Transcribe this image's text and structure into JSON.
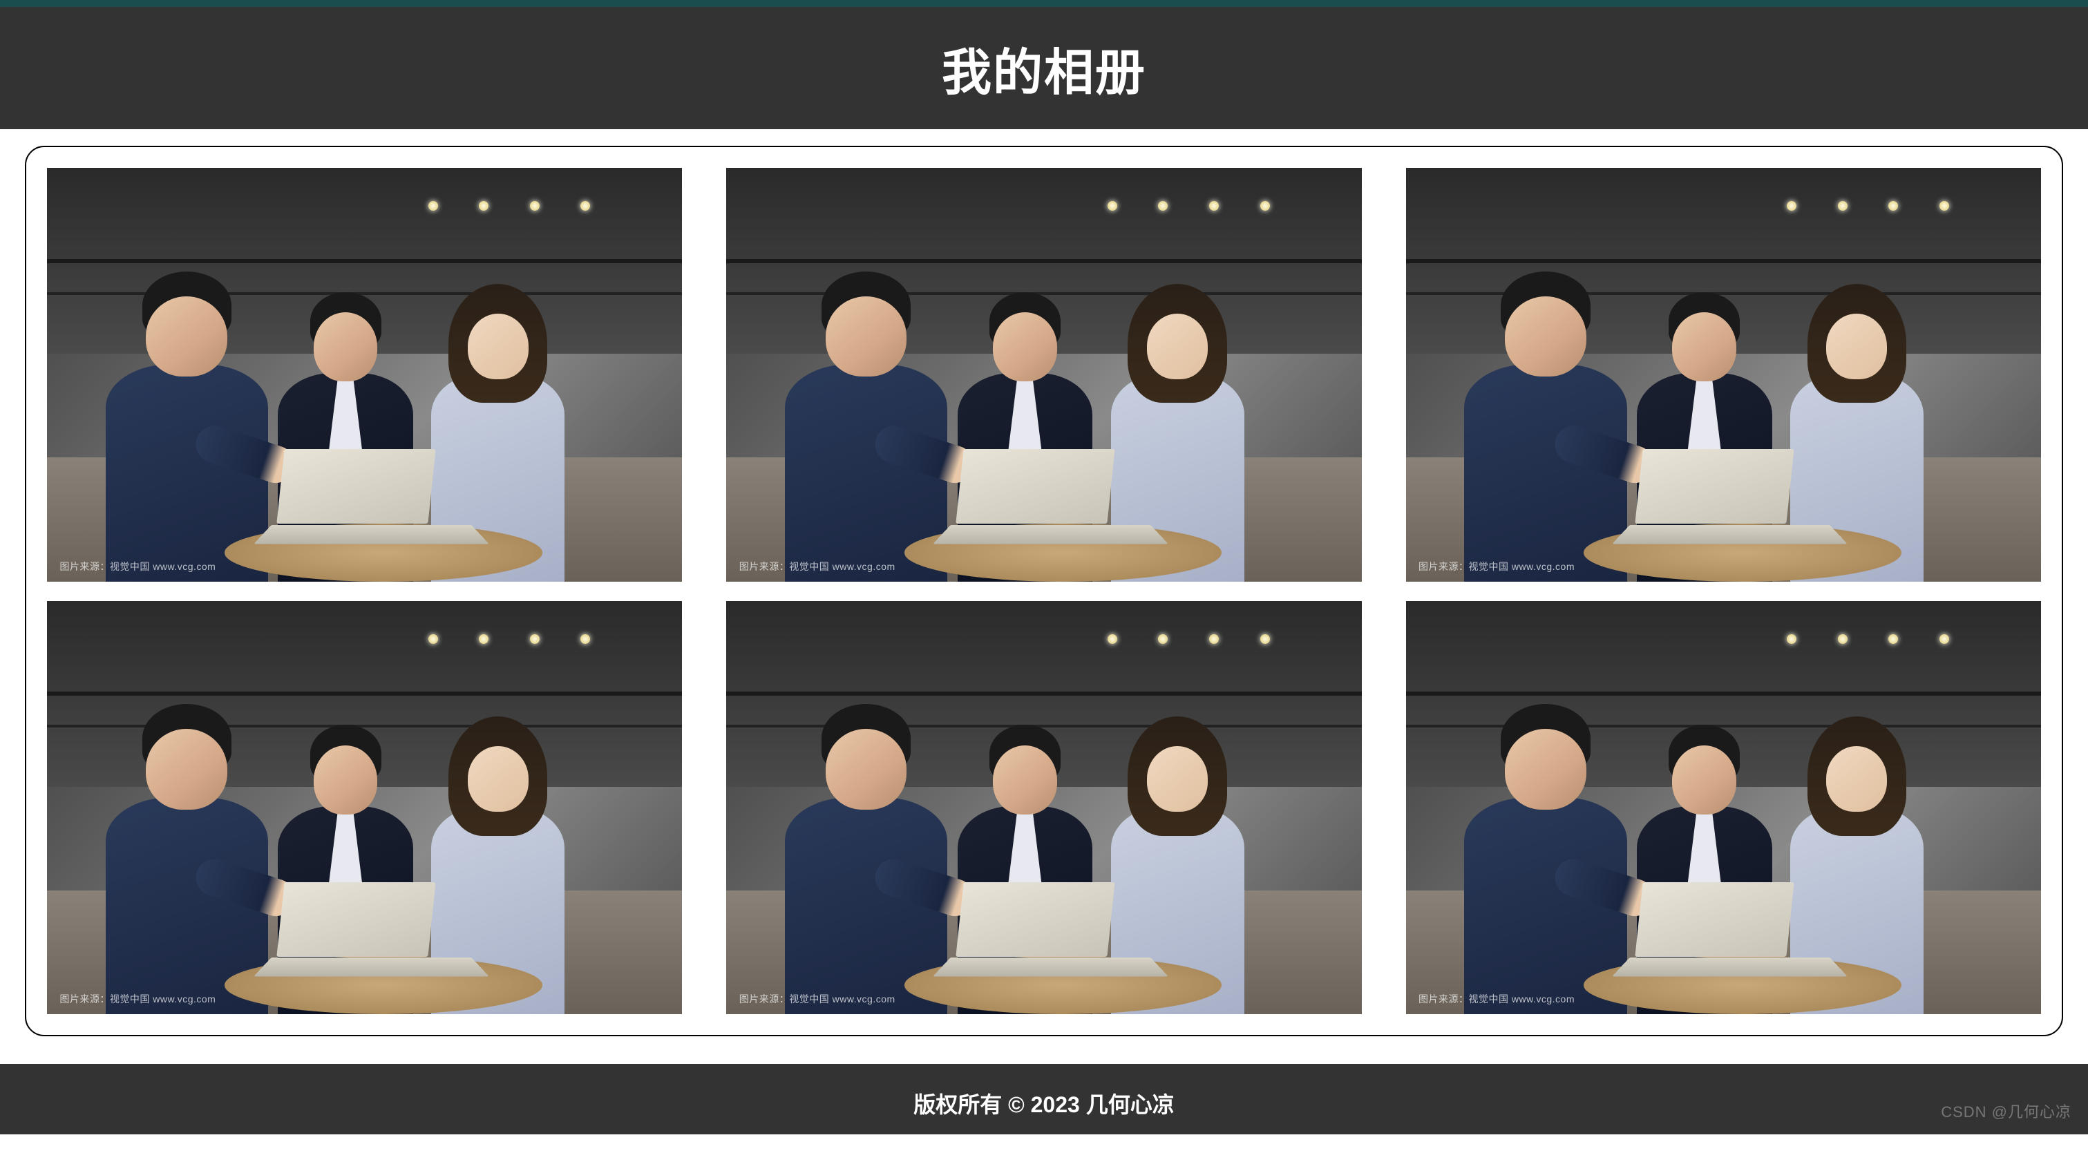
{
  "header": {
    "title": "我的相册"
  },
  "gallery": {
    "photo_count": 6,
    "image_watermark": "图片来源：视觉中国 www.vcg.com",
    "image_description": "three-business-people-laptop-office"
  },
  "footer": {
    "copyright": "版权所有 © 2023 几何心凉"
  },
  "page_watermark": "CSDN @几何心凉",
  "colors": {
    "header_bg": "#333333",
    "footer_bg": "#333333",
    "top_accent": "#1a4d4d",
    "page_bg": "#ffffff",
    "border": "#000000"
  }
}
